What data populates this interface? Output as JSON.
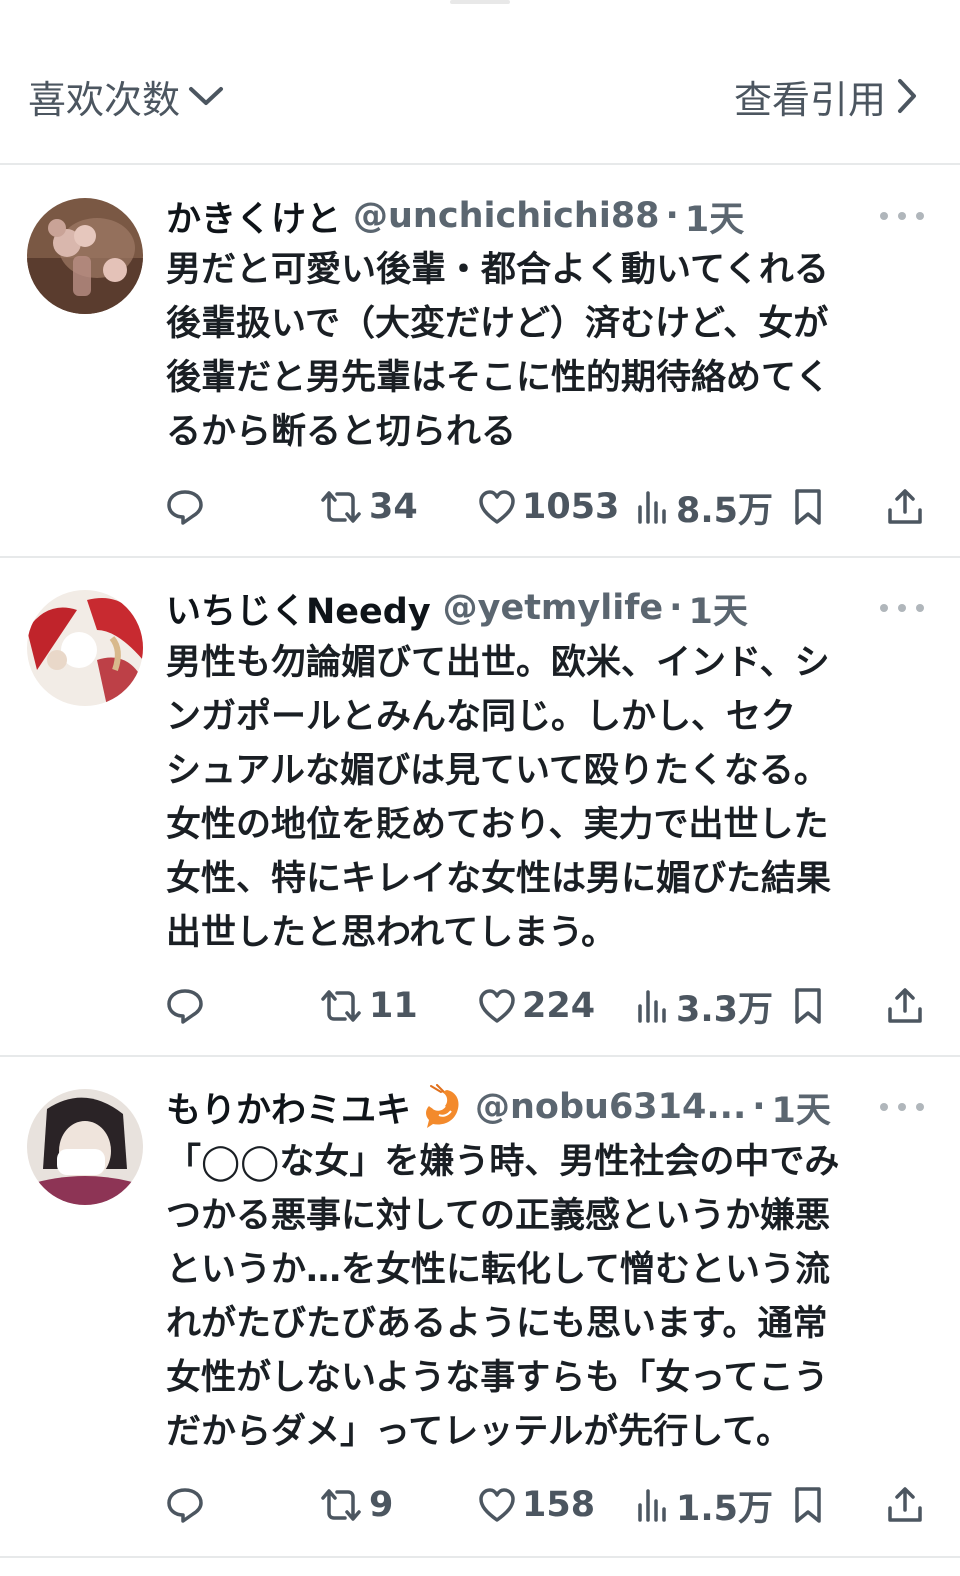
{
  "header": {
    "sort_label": "喜欢次数",
    "quotes_label": "查看引用"
  },
  "tweets": [
    {
      "name": "かきくけと",
      "handle": "@unchichichi88",
      "time": "1天",
      "text": "男だと可愛い後輩・都合よく動いてくれる\n後輩扱いで（大変だけど）済むけど、女が\n後輩だと男先輩はそこに性的期待絡めてく\nるから断ると切られる",
      "retweets": "34",
      "likes": "1053",
      "views": "8.5万"
    },
    {
      "name": "いちじくNeedy",
      "handle": "@yetmylife",
      "time": "1天",
      "text": "男性も勿論媚びて出世。欧米、インド、シ\nンガポールとみんな同じ。しかし、セク\nシュアルな媚びは見ていて殴りたくなる。\n女性の地位を貶めており、実力で出世した\n女性、特にキレイな女性は男に媚びた結果\n出世したと思われてしまう。",
      "retweets": "11",
      "likes": "224",
      "views": "3.3万"
    },
    {
      "name": "もりかわミユキ",
      "handle": "@nobu6314...",
      "time": "1天",
      "text": "「◯◯な女」を嫌う時、男性社会の中でみ\nつかる悪事に対しての正義感というか嫌悪\nというか…を女性に転化して憎むという流\nれがたびたびあるようにも思います。通常\n女性がしないような事すらも「女ってこう\nだからダメ」ってレッテルが先行して。",
      "retweets": "9",
      "likes": "158",
      "views": "1.5万"
    }
  ]
}
